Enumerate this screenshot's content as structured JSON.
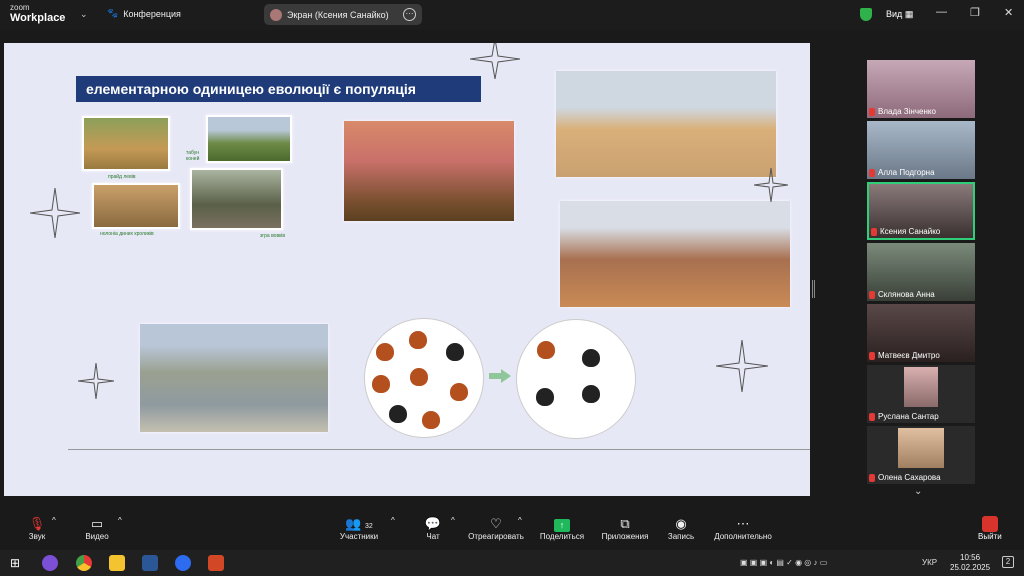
{
  "app": {
    "brand_top": "zoom",
    "brand_main": "Workplace",
    "conference_label": "Конференция"
  },
  "share_pill": {
    "label": "Экран (Ксения Санайко)"
  },
  "topright": {
    "view_label": "Вид"
  },
  "slide": {
    "title": "елементарною одиницею еволюції є популяція",
    "captions": [
      "прайд левів",
      "табун коней",
      "нолоніа диних кроликів",
      "згра вовків"
    ]
  },
  "participants": [
    {
      "name": "Влада Зінченко"
    },
    {
      "name": "Алла Подгорна"
    },
    {
      "name": "Ксения Санайко"
    },
    {
      "name": "Склянова Анна"
    },
    {
      "name": "Матвеєв Дмитро"
    },
    {
      "name": "Руслана Сантар"
    },
    {
      "name": "Олена Сахарова"
    }
  ],
  "toolbar": {
    "audio": "Звук",
    "video": "Видео",
    "participants": "Участники",
    "participants_count": "32",
    "chat": "Чат",
    "react": "Отреагировать",
    "share": "Поделиться",
    "apps": "Приложения",
    "record": "Запись",
    "more": "Дополнительно",
    "leave": "Выйти"
  },
  "taskbar": {
    "lang": "УКР",
    "time": "10:56",
    "date": "25.02.2025",
    "notifications": "2"
  },
  "colors": {
    "accent_green": "#2fcf7a",
    "title_blue": "#1f3b7a",
    "leave_red": "#d9342b",
    "share_green": "#1fb85a"
  }
}
